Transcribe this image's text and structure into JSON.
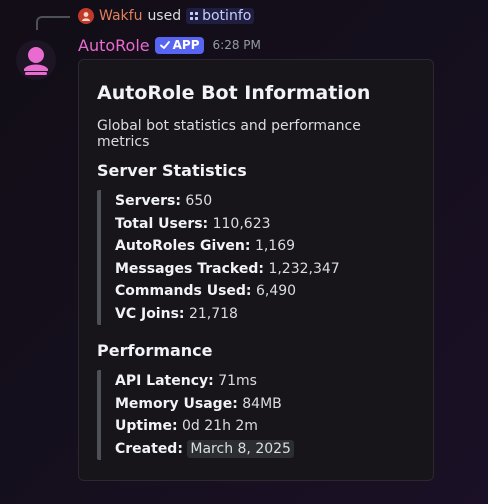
{
  "reply": {
    "user": "Wakfu",
    "used_text": "used",
    "command": "botinfo"
  },
  "message": {
    "bot_name": "AutoRole",
    "badge": "APP",
    "time": "6:28 PM"
  },
  "embed": {
    "title": "AutoRole Bot Information",
    "description": "Global bot statistics and performance metrics",
    "server_stats": {
      "heading": "Server Statistics",
      "rows": [
        {
          "label": "Servers:",
          "value": "650"
        },
        {
          "label": "Total Users:",
          "value": "110,623"
        },
        {
          "label": "AutoRoles Given:",
          "value": "1,169"
        },
        {
          "label": "Messages Tracked:",
          "value": "1,232,347"
        },
        {
          "label": "Commands Used:",
          "value": "6,490"
        },
        {
          "label": "VC Joins:",
          "value": "21,718"
        }
      ]
    },
    "performance": {
      "heading": "Performance",
      "rows": [
        {
          "label": "API Latency:",
          "value": "71ms"
        },
        {
          "label": "Memory Usage:",
          "value": "84MB"
        },
        {
          "label": "Uptime:",
          "value": "0d 21h 2m"
        },
        {
          "label": "Created:",
          "value": "March 8, 2025"
        }
      ]
    }
  },
  "colors": {
    "bot_name": "#e96bd0",
    "app_badge": "#5865f2",
    "reply_user": "#e0805c",
    "avatar_glyph": "#e96bd0"
  },
  "icons": {
    "reply_avatar": "user-avatar-icon",
    "command": "slash-command-icon",
    "bot_avatar": "bot-avatar-icon",
    "badge": "checkmark-icon"
  }
}
